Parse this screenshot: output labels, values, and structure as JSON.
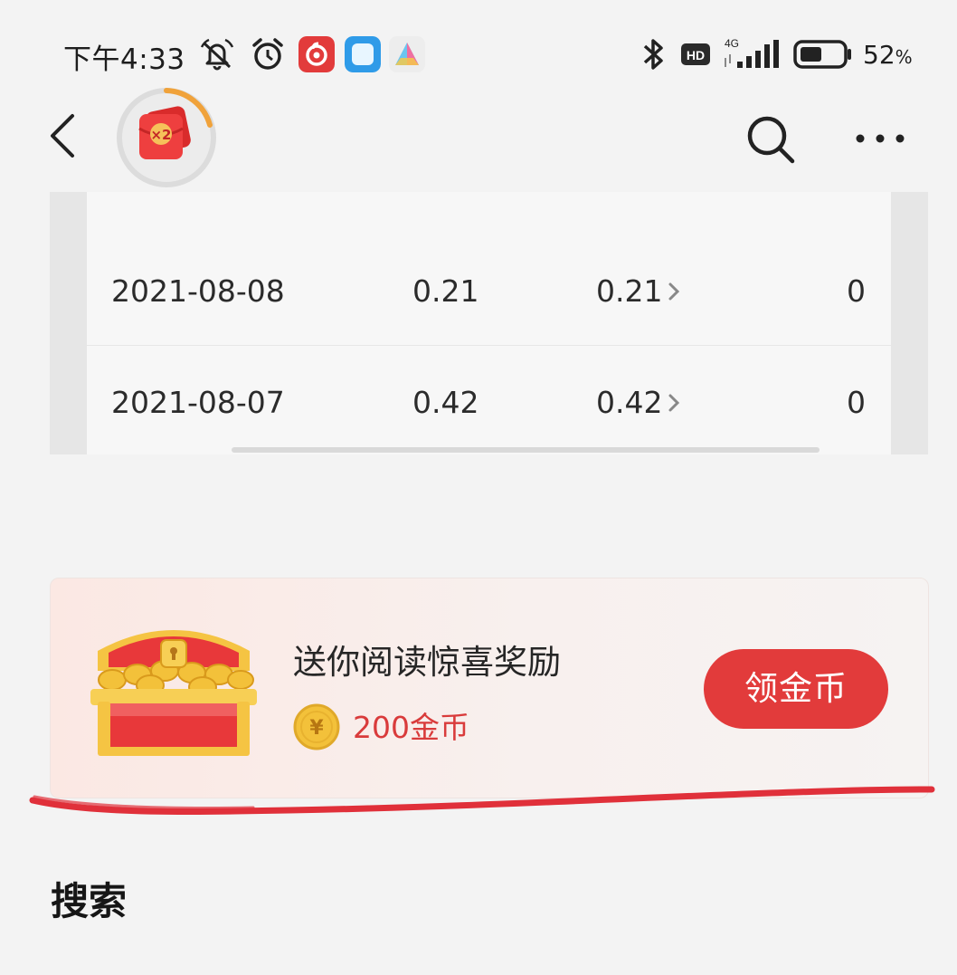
{
  "status_bar": {
    "time": "下午4:33",
    "hd_label": "HD",
    "network_label": "4G",
    "battery_percent": "52",
    "battery_symbol": "%",
    "battery_level": 0.52
  },
  "nav": {
    "avatar_badge": "×2"
  },
  "table": {
    "rows": [
      {
        "date": "2021-08-08",
        "value1": "0.21",
        "value2": "0.21",
        "value3": "0"
      },
      {
        "date": "2021-08-07",
        "value1": "0.42",
        "value2": "0.42",
        "value3": "0"
      }
    ]
  },
  "reward": {
    "title": "送你阅读惊喜奖励",
    "amount": "200金币",
    "button_label": "领金币",
    "coin_symbol": "¥"
  },
  "section": {
    "title": "搜索"
  },
  "colors": {
    "accent_red": "#e23b3b",
    "annotation_red": "#e0303a",
    "coin_gold": "#f3c13a"
  }
}
